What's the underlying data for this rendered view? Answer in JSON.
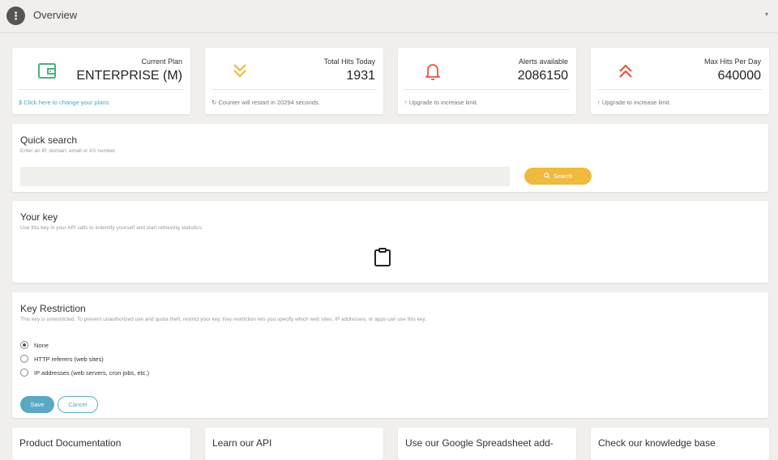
{
  "header": {
    "menu_glyph": "⋮",
    "title": "Overview",
    "caret": "▾"
  },
  "stats": [
    {
      "label": "Current Plan",
      "value": "ENTERPRISE (M)",
      "footer_icon": "$",
      "footer": "Click here to change your plans",
      "icon": "wallet-icon",
      "color": "#4caf7d"
    },
    {
      "label": "Total Hits Today",
      "value": "1931",
      "footer_icon": "↻",
      "footer": "Counter will restart in 20294 seconds.",
      "icon": "double-chevron-down-icon",
      "color": "#f0b93f"
    },
    {
      "label": "Alerts available",
      "value": "2086150",
      "footer_icon": "↑",
      "footer": "Upgrade to increase limit.",
      "icon": "bell-icon",
      "color": "#e8553a"
    },
    {
      "label": "Max Hits Per Day",
      "value": "640000",
      "footer_icon": "↑",
      "footer": "Upgrade to increase limit.",
      "icon": "double-chevron-up-icon",
      "color": "#e8553a"
    }
  ],
  "quick_search": {
    "title": "Quick search",
    "subtitle": "Enter an IP, domain, email or AS number.",
    "input_value": "",
    "button_label": "Search"
  },
  "your_key": {
    "title": "Your key",
    "subtitle": "Use this key in your API calls to indentify yourself and start retrieving statistics.",
    "icon": "clipboard-icon"
  },
  "key_restriction": {
    "title": "Key Restriction",
    "subtitle": "This key is unrestricted. To prevent unauthorized use and quota theft, restrict your key. Key restriction lets you specify which web sites, IP addresses, or apps can use this key.",
    "options": [
      {
        "label": "None",
        "checked": true
      },
      {
        "label": "HTTP referers (web sites)",
        "checked": false
      },
      {
        "label": "IP addresses (web servers, cron jobs, etc.)",
        "checked": false
      }
    ],
    "save_label": "Save",
    "cancel_label": "Cancel"
  },
  "bottom_cards": [
    {
      "title": "Product Documentation"
    },
    {
      "title": "Learn our API"
    },
    {
      "title": "Use our Google Spreadsheet add-"
    },
    {
      "title": "Check our knowledge base"
    }
  ]
}
